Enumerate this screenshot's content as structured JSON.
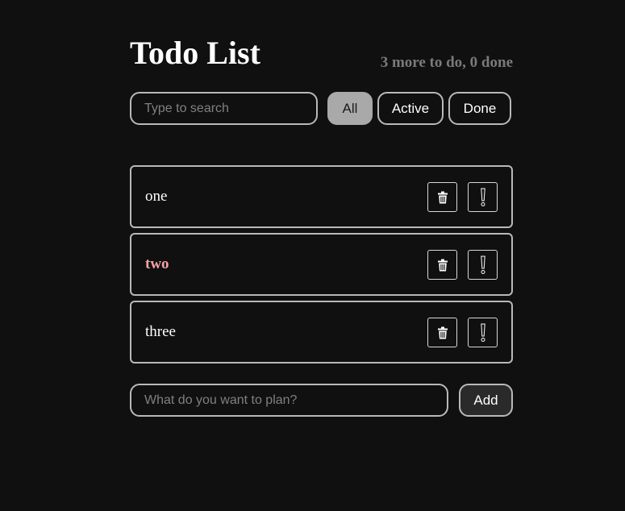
{
  "header": {
    "title": "Todo List",
    "summary": "3 more to do, 0 done"
  },
  "search": {
    "placeholder": "Type to search",
    "value": ""
  },
  "filters": [
    {
      "label": "All",
      "selected": true
    },
    {
      "label": "Active",
      "selected": false
    },
    {
      "label": "Done",
      "selected": false
    }
  ],
  "todos": [
    {
      "label": "one",
      "important": false,
      "done": false
    },
    {
      "label": "two",
      "important": true,
      "done": false
    },
    {
      "label": "three",
      "important": false,
      "done": false
    }
  ],
  "item_actions": {
    "delete_icon": "trash-icon",
    "important_icon": "exclamation-icon"
  },
  "add_form": {
    "placeholder": "What do you want to plan?",
    "value": "",
    "button_label": "Add"
  },
  "colors": {
    "background": "#101010",
    "border": "#b9b9b9",
    "selected_filter": "#a9a9a9",
    "important_text": "#f6a2a2",
    "summary_text": "#7a7a7a"
  }
}
